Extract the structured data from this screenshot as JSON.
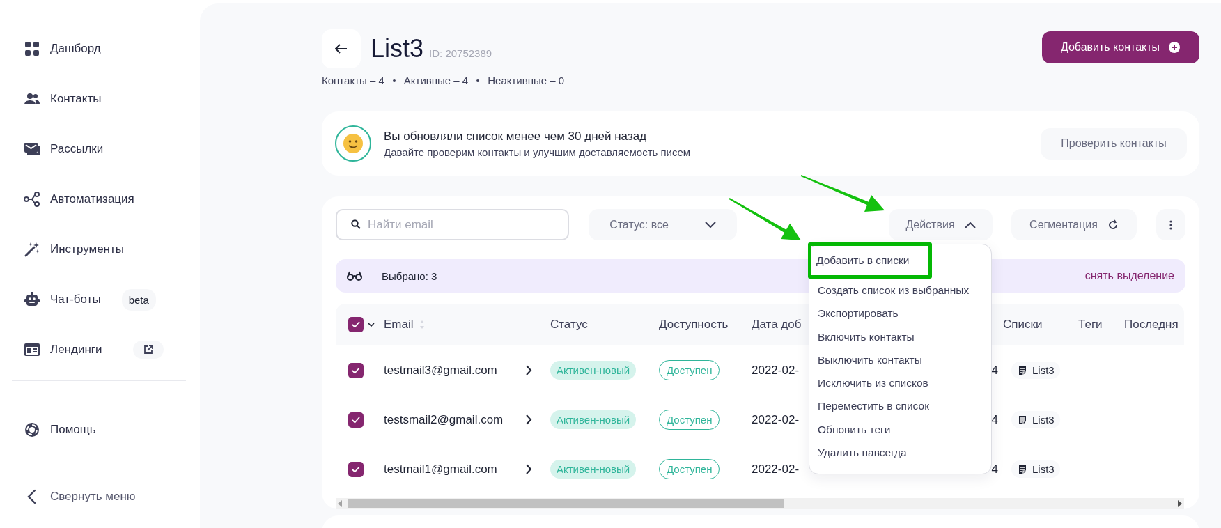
{
  "sidebar": {
    "items": [
      {
        "label": "Дашборд"
      },
      {
        "label": "Контакты"
      },
      {
        "label": "Рассылки"
      },
      {
        "label": "Автоматизация"
      },
      {
        "label": "Инструменты"
      },
      {
        "label": "Чат-боты",
        "badge": "beta"
      },
      {
        "label": "Лендинги",
        "external_link": true
      }
    ],
    "footer_items": [
      {
        "label": "Помощь"
      }
    ],
    "collapse": "Свернуть меню"
  },
  "header": {
    "title": "List3",
    "id": "ID: 20752389",
    "add_button": "Добавить контакты",
    "stats": [
      "Контакты – 4",
      "Активные – 4",
      "Неактивные – 0"
    ]
  },
  "notice": {
    "title": "Вы обновляли список менее чем 30 дней назад",
    "text": "Давайте проверим контакты и улучшим доставляемость писем",
    "button": "Проверить контакты"
  },
  "toolbar": {
    "search": {
      "placeholder": "Найти email"
    },
    "status_filter": "Статус: все",
    "actions": {
      "label": "Действия",
      "expanded": true
    },
    "segmentation": "Сегментация"
  },
  "selection": {
    "text": "Выбрано: 3",
    "clear": "снять выделение"
  },
  "table": {
    "select_all": {
      "checked": true
    },
    "columns": [
      {
        "label": "Email",
        "sortable": true
      },
      {
        "label": "Статус"
      },
      {
        "label": "Доступность"
      },
      {
        "label": "Дата доб"
      },
      {
        "label": "Списки"
      },
      {
        "label": "Теги"
      },
      {
        "label": "Последня"
      }
    ],
    "rows": [
      {
        "checked": true,
        "email": "testmail3@gmail.com",
        "status": "Активен-новый",
        "availability": "Доступен",
        "date": "2022-02-",
        "column_5": "4",
        "list": "List3"
      },
      {
        "checked": true,
        "email": "testsmail2@gmail.com",
        "status": "Активен-новый",
        "availability": "Доступен",
        "date": "2022-02-",
        "column_5": "4",
        "list": "List3"
      },
      {
        "checked": true,
        "email": "testmail1@gmail.com",
        "status": "Активен-новый",
        "availability": "Доступен",
        "date": "2022-02-",
        "column_5": "4",
        "list": "List3"
      }
    ]
  },
  "actions_menu": {
    "items": [
      {
        "label": "Добавить в списки",
        "highlighted": true
      },
      {
        "label": "Создать список из выбранных",
        "highlighted": false
      },
      {
        "label": "Экспортировать",
        "highlighted": false
      },
      {
        "label": "Включить контакты",
        "highlighted": false
      },
      {
        "label": "Выключить контакты",
        "highlighted": false
      },
      {
        "label": "Исключить из списков",
        "highlighted": false
      },
      {
        "label": "Переместить в список",
        "highlighted": false
      },
      {
        "label": "Обновить теги",
        "highlighted": false
      },
      {
        "label": "Удалить навсегда",
        "highlighted": false
      }
    ]
  },
  "annotations": [
    {
      "kind": "arrow"
    },
    {
      "kind": "arrow"
    }
  ]
}
